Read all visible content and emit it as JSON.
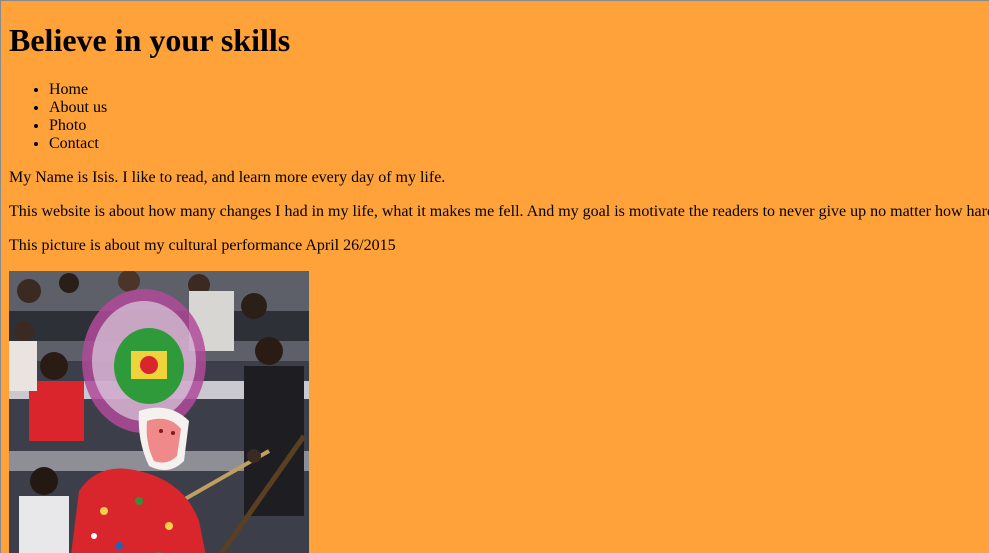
{
  "page": {
    "heading": "Believe in your skills"
  },
  "nav": {
    "items": [
      {
        "label": "Home"
      },
      {
        "label": "About us"
      },
      {
        "label": "Photo"
      },
      {
        "label": "Contact"
      }
    ]
  },
  "main": {
    "intro": "My Name is Isis. I like to read, and learn more every day of my life.",
    "about": "This website is about how many changes I had in my life, what it makes me fell. And my goal is motivate the readers to never give up no matter how hard",
    "caption": "This picture is about my cultural performance April 26/2015"
  },
  "colors": {
    "background": "#ffa23a"
  }
}
